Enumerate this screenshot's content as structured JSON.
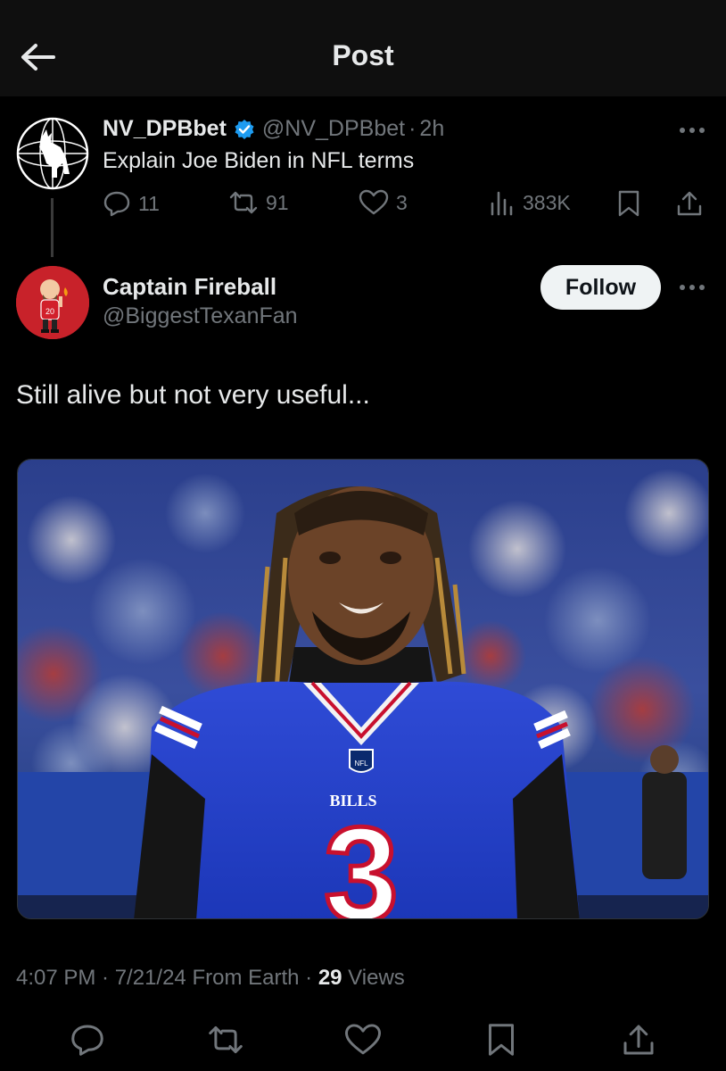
{
  "header": {
    "title": "Post"
  },
  "parent_post": {
    "display_name": "NV_DPBbet",
    "handle": "@NV_DPBbet",
    "separator": "·",
    "time": "2h",
    "text": "Explain Joe Biden in NFL terms",
    "replies": "11",
    "reposts": "91",
    "likes": "3",
    "views": "383K"
  },
  "reply_post": {
    "display_name": "Captain Fireball",
    "handle": "@BiggestTexanFan",
    "follow_label": "Follow",
    "text": "Still alive but not very useful...",
    "image": {
      "jersey_team": "BILLS",
      "jersey_number": "3",
      "badge": "NFL"
    },
    "timestamp": "4:07 PM · 7/21/24 From Earth · ",
    "views_count": "29",
    "views_label": " Views"
  },
  "icons": [
    "back-arrow-icon",
    "verified-badge-icon",
    "more-icon",
    "reply-icon",
    "repost-icon",
    "like-icon",
    "views-icon",
    "bookmark-icon",
    "share-icon"
  ],
  "colors": {
    "background": "#000000",
    "topbar": "#0f0f0f",
    "text": "#e7e9ea",
    "muted": "#71767b",
    "verified": "#1d9bf0",
    "follow_bg": "#eff3f4"
  }
}
